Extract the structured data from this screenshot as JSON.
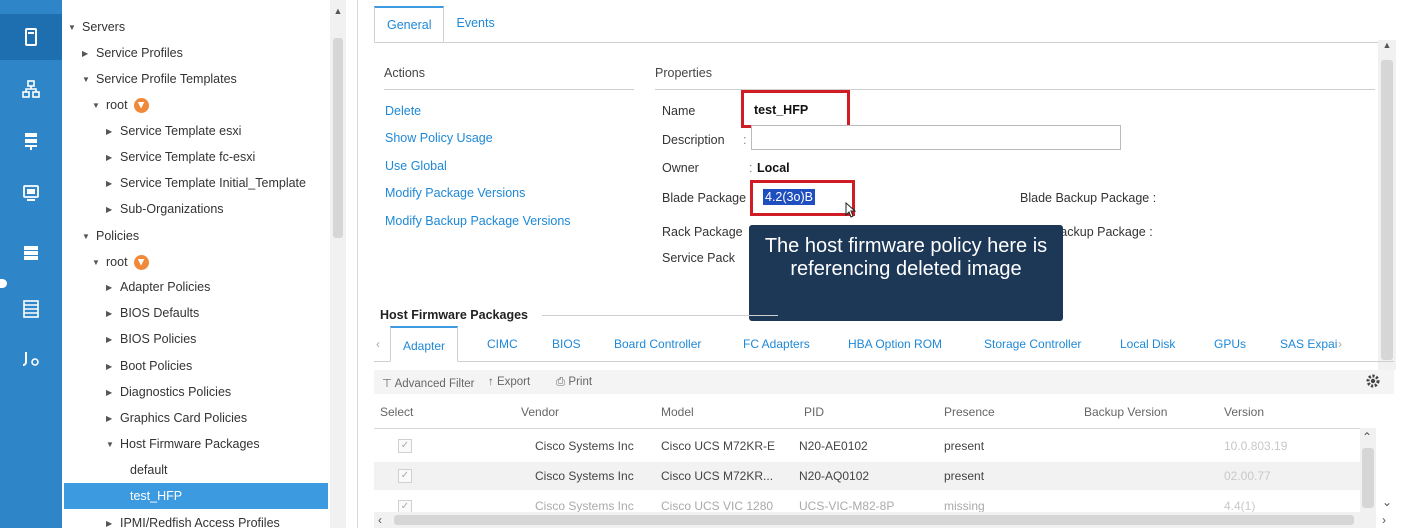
{
  "rail": {
    "icons": [
      "equipment-icon",
      "network-icon",
      "servers-icon",
      "vm-icon",
      "storage-icon",
      "chassis-icon",
      "admin-icon"
    ]
  },
  "tree": {
    "items": [
      {
        "label": "Servers",
        "arrow": "▼"
      },
      {
        "label": "Service Profiles",
        "arrow": "▶"
      },
      {
        "label": "Service Profile Templates",
        "arrow": "▼"
      },
      {
        "label": "root",
        "arrow": "▼"
      },
      {
        "label": "Service Template esxi",
        "arrow": "▶"
      },
      {
        "label": "Service Template fc-esxi",
        "arrow": "▶"
      },
      {
        "label": "Service Template Initial_Template",
        "arrow": "▶"
      },
      {
        "label": "Sub-Organizations",
        "arrow": "▶"
      },
      {
        "label": "Policies",
        "arrow": "▼"
      },
      {
        "label": "root",
        "arrow": "▼"
      },
      {
        "label": "Adapter Policies",
        "arrow": "▶"
      },
      {
        "label": "BIOS Defaults",
        "arrow": "▶"
      },
      {
        "label": "BIOS Policies",
        "arrow": "▶"
      },
      {
        "label": "Boot Policies",
        "arrow": "▶"
      },
      {
        "label": "Diagnostics Policies",
        "arrow": "▶"
      },
      {
        "label": "Graphics Card Policies",
        "arrow": "▶"
      },
      {
        "label": "Host Firmware Packages",
        "arrow": "▼"
      },
      {
        "label": "default",
        "arrow": ""
      },
      {
        "label": "test_HFP",
        "arrow": ""
      },
      {
        "label": "IPMI/Redfish Access Profiles",
        "arrow": "▶"
      }
    ]
  },
  "tabs": [
    "General",
    "Events"
  ],
  "actions": {
    "title": "Actions",
    "links": [
      "Delete",
      "Show Policy Usage",
      "Use Global",
      "Modify Package Versions",
      "Modify Backup Package Versions"
    ]
  },
  "properties": {
    "title": "Properties",
    "name_label": "Name",
    "name_value": "test_HFP",
    "description_label": "Description",
    "owner_label": "Owner",
    "owner_value": "Local",
    "blade_package_label": "Blade Package",
    "blade_package_value": "4.2(3o)B",
    "rack_package_label": "Rack Package",
    "service_pack_label": "Service Pack",
    "blade_backup_label": "Blade Backup Package :",
    "rack_backup_label": "Rack Backup Package :"
  },
  "callout": "The host firmware policy here is referencing deleted image",
  "host_firmware": {
    "title": "Host Firmware Packages",
    "sub_tabs": [
      "Adapter",
      "CIMC",
      "BIOS",
      "Board Controller",
      "FC Adapters",
      "HBA Option ROM",
      "Storage Controller",
      "Local Disk",
      "GPUs",
      "SAS Expai"
    ],
    "toolbar": {
      "filter": "Advanced Filter",
      "export": "Export",
      "print": "Print"
    },
    "columns": [
      "Select",
      "Vendor",
      "Model",
      "PID",
      "Presence",
      "Backup Version",
      "Version"
    ],
    "rows": [
      {
        "vendor": "Cisco Systems Inc",
        "model": "Cisco UCS M72KR-E",
        "pid": "N20-AE0102",
        "presence": "present",
        "backup": "",
        "version": "10.0.803.19"
      },
      {
        "vendor": "Cisco Systems Inc",
        "model": "Cisco UCS M72KR...",
        "pid": "N20-AQ0102",
        "presence": "present",
        "backup": "",
        "version": "02.00.77"
      },
      {
        "vendor": "Cisco Systems Inc",
        "model": "Cisco UCS VIC 1280",
        "pid": "UCS-VIC-M82-8P",
        "presence": "missing",
        "backup": "",
        "version": "4.4(1)"
      }
    ]
  },
  "colors": {
    "accent": "#3c9be0",
    "rail": "#2e86c9",
    "highlight_box": "#d01c24",
    "callout_bg": "#1d3757"
  }
}
